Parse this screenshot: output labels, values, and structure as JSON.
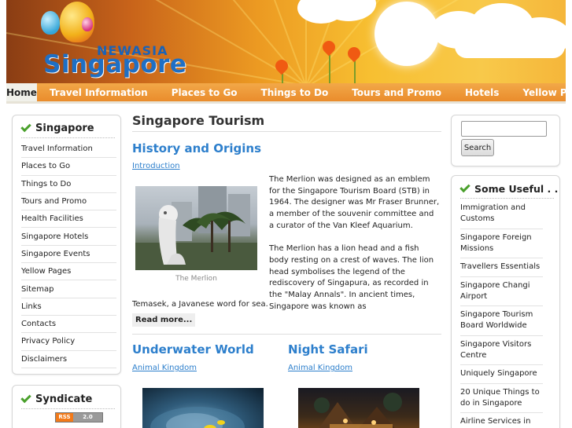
{
  "header": {
    "logo_top": "NEWASIA",
    "logo_main": "Singapore"
  },
  "nav": {
    "items": [
      {
        "label": "Home",
        "active": true
      },
      {
        "label": "Travel Information"
      },
      {
        "label": "Places to Go"
      },
      {
        "label": "Things to Do"
      },
      {
        "label": "Tours and Promo"
      },
      {
        "label": "Hotels"
      },
      {
        "label": "Yellow Pages"
      }
    ]
  },
  "left_sidebar": {
    "title": "Singapore",
    "items": [
      "Travel Information",
      "Places to Go",
      "Things to Do",
      "Tours and Promo",
      "Health Facilities",
      "Singapore Hotels",
      "Singapore Events",
      "Yellow Pages",
      "Sitemap",
      "Links",
      "Contacts",
      "Privacy Policy",
      "Disclaimers"
    ]
  },
  "syndicate": {
    "title": "Syndicate",
    "badge_left": "RSS",
    "badge_right": "2.0"
  },
  "main": {
    "page_title": "Singapore Tourism",
    "history": {
      "heading": "History and Origins",
      "category": "Introduction",
      "image_caption": "The Merlion",
      "paragraph1": "The Merlion was designed as an emblem for the Singapore Tourism Board (STB) in 1964. The designer was Mr Fraser Brunner, a member of the souvenir committee and a curator of the Van Kleef Aquarium.",
      "paragraph2": "The Merlion has a lion head and a fish body resting on a crest of waves. The lion head symbolises the legend of the rediscovery of Singapura, as recorded in the \"Malay Annals\". In ancient times, Singapore was known as",
      "paragraph2_tail": "Temasek, a Javanese word for sea.",
      "read_more": "Read more..."
    },
    "underwater": {
      "heading": "Underwater World",
      "category": "Animal Kingdom"
    },
    "night_safari": {
      "heading": "Night Safari",
      "category": "Animal Kingdom"
    }
  },
  "right_sidebar": {
    "search": {
      "value": "",
      "placeholder": "",
      "button_label": "Search"
    },
    "useful": {
      "title": "Some Useful . .",
      "items": [
        "Immigration and Customs",
        "Singapore Foreign Missions",
        "Travellers Essentials",
        "Singapore Changi Airport",
        "Singapore Tourism Board Worldwide",
        "Singapore Visitors Centre",
        "Uniquely Singapore",
        "20 Unique Things to do in Singapore",
        "Airline Services in Singapore"
      ]
    }
  },
  "colors": {
    "nav_orange": "#ea8c2c",
    "link_blue": "#2d7fcc",
    "check_green": "#4aa02c",
    "rss_orange": "#f27a1a"
  }
}
